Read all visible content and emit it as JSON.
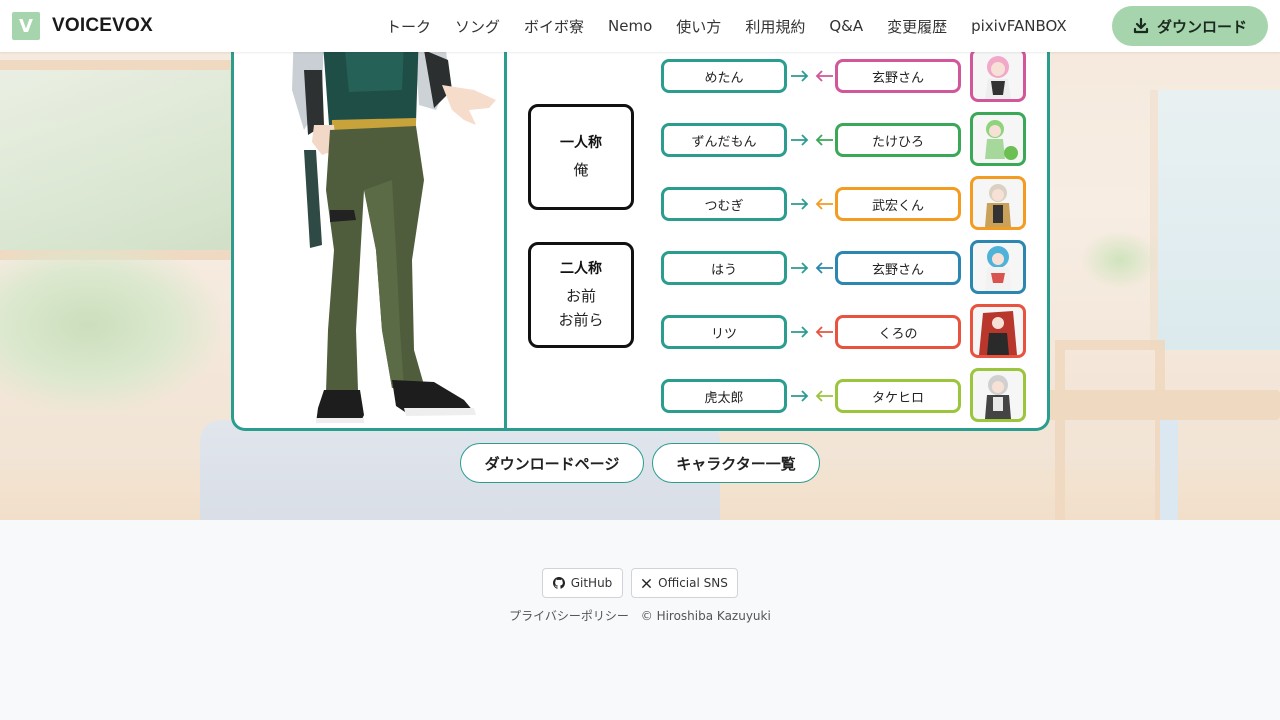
{
  "header": {
    "logo_letter": "V",
    "brand": "VOICEVOX",
    "nav": [
      "トーク",
      "ソング",
      "ボイボ寮",
      "Nemo",
      "使い方",
      "利用規約",
      "Q&A",
      "変更履歴",
      "pixivFANBOX"
    ],
    "download_label": "ダウンロード"
  },
  "pronouns": {
    "first_person": {
      "title": "一人称",
      "values": [
        "俺"
      ]
    },
    "second_person": {
      "title": "二人称",
      "values": [
        "お前",
        "お前ら"
      ]
    }
  },
  "relations": [
    {
      "from": "めたん",
      "to": "玄野さん",
      "color": "#d1569a",
      "thumb": "pink-hair-character"
    },
    {
      "from": "ずんだもん",
      "to": "たけひろ",
      "color": "#3aa857",
      "thumb": "green-character"
    },
    {
      "from": "つむぎ",
      "to": "武宏くん",
      "color": "#f39c21",
      "thumb": "blonde-character"
    },
    {
      "from": "はう",
      "to": "玄野さん",
      "color": "#2b86b0",
      "thumb": "blue-hair-character"
    },
    {
      "from": "リツ",
      "to": "くろの",
      "color": "#e8533f",
      "thumb": "red-hair-character"
    },
    {
      "from": "虎太郎",
      "to": "タケヒロ",
      "color": "#9bc53d",
      "thumb": "grey-hair-character"
    }
  ],
  "accent_color": "#2a9d8f",
  "buttons": {
    "download_page": "ダウンロードページ",
    "character_list": "キャラクター一覧"
  },
  "footer": {
    "github": "GitHub",
    "sns": "Official SNS",
    "privacy": "プライバシーポリシー",
    "copyright": "© Hiroshiba Kazuyuki"
  }
}
